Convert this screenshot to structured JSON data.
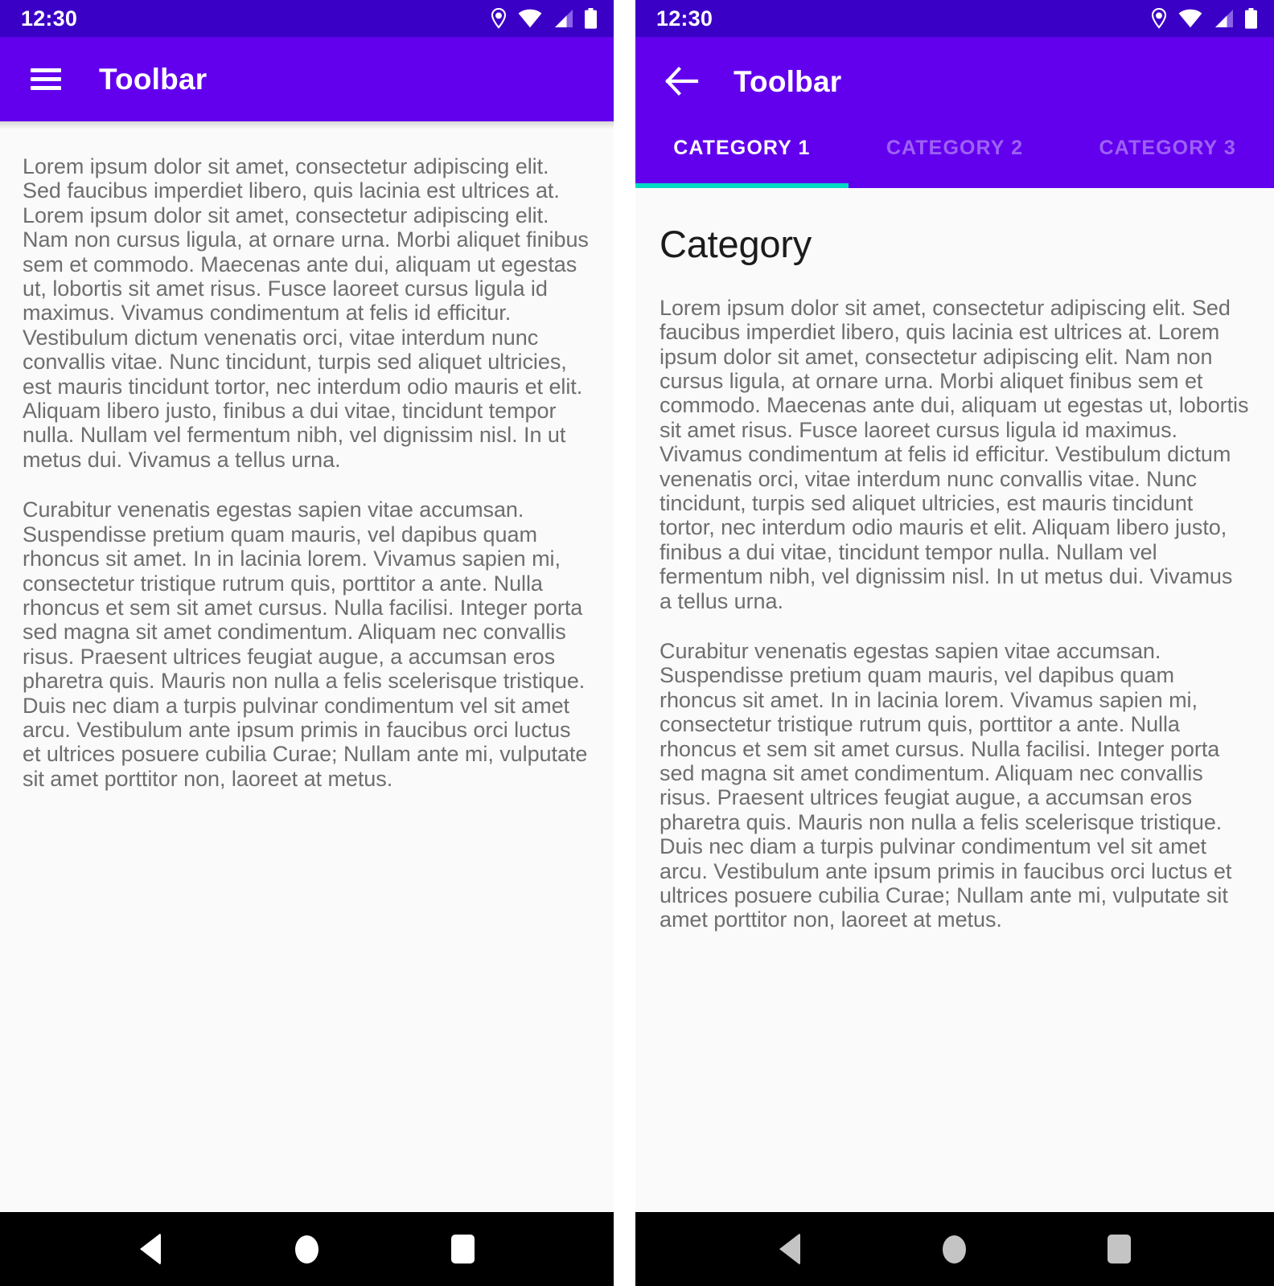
{
  "statusbar": {
    "time": "12:30",
    "icons": [
      "location-pin-icon",
      "wifi-icon",
      "cellular-signal-icon",
      "battery-icon"
    ]
  },
  "colors": {
    "status_bar": "#3b00c6",
    "toolbar": "#6200ee",
    "tab_indicator": "#03dac5",
    "content_background": "#fafafa",
    "body_text": "#6e6e6e",
    "heading_text": "#1c1c1c",
    "system_nav": "#000000",
    "system_nav_icon_left": "#ffffff",
    "system_nav_icon_right": "#c4c4c4"
  },
  "left_panel": {
    "toolbar": {
      "nav_icon": "hamburger-menu-icon",
      "title": "Toolbar"
    },
    "content": {
      "paragraphs": [
        "Lorem ipsum dolor sit amet, consectetur adipiscing elit. Sed faucibus imperdiet libero, quis lacinia est ultrices at. Lorem ipsum dolor sit amet, consectetur adipiscing elit. Nam non cursus ligula, at ornare urna. Morbi aliquet finibus sem et commodo. Maecenas ante dui, aliquam ut egestas ut, lobortis sit amet risus. Fusce laoreet cursus ligula id maximus. Vivamus condimentum at felis id efficitur. Vestibulum dictum venenatis orci, vitae interdum nunc convallis vitae. Nunc tincidunt, turpis sed aliquet ultricies, est mauris tincidunt tortor, nec interdum odio mauris et elit. Aliquam libero justo, finibus a dui vitae, tincidunt tempor nulla. Nullam vel fermentum nibh, vel dignissim nisl. In ut metus dui. Vivamus a tellus urna.",
        "Curabitur venenatis egestas sapien vitae accumsan. Suspendisse pretium quam mauris, vel dapibus quam rhoncus sit amet. In in lacinia lorem. Vivamus sapien mi, consectetur tristique rutrum quis, porttitor a ante. Nulla rhoncus et sem sit amet cursus. Nulla facilisi. Integer porta sed magna sit amet condimentum. Aliquam nec convallis risus. Praesent ultrices feugiat augue, a accumsan eros pharetra quis. Mauris non nulla a felis scelerisque tristique. Duis nec diam a turpis pulvinar condimentum vel sit amet arcu. Vestibulum ante ipsum primis in faucibus orci luctus et ultrices posuere cubilia Curae; Nullam ante mi, vulputate sit amet porttitor non, laoreet at metus."
      ]
    },
    "system_nav": {
      "back": "back-triangle-icon",
      "home": "home-circle-icon",
      "recents": "recents-square-icon"
    }
  },
  "right_panel": {
    "toolbar": {
      "nav_icon": "back-arrow-icon",
      "title": "Toolbar"
    },
    "tabs": [
      {
        "label": "CATEGORY 1",
        "active": true
      },
      {
        "label": "CATEGORY 2",
        "active": false
      },
      {
        "label": "CATEGORY 3",
        "active": false
      }
    ],
    "content": {
      "heading": "Category",
      "paragraphs": [
        "Lorem ipsum dolor sit amet, consectetur adipiscing elit. Sed faucibus imperdiet libero, quis lacinia est ultrices at. Lorem ipsum dolor sit amet, consectetur adipiscing elit. Nam non cursus ligula, at ornare urna. Morbi aliquet finibus sem et commodo. Maecenas ante dui, aliquam ut egestas ut, lobortis sit amet risus. Fusce laoreet cursus ligula id maximus. Vivamus condimentum at felis id efficitur. Vestibulum dictum venenatis orci, vitae interdum nunc convallis vitae. Nunc tincidunt, turpis sed aliquet ultricies, est mauris tincidunt tortor, nec interdum odio mauris et elit. Aliquam libero justo, finibus a dui vitae, tincidunt tempor nulla. Nullam vel fermentum nibh, vel dignissim nisl. In ut metus dui. Vivamus a tellus urna.",
        "Curabitur venenatis egestas sapien vitae accumsan. Suspendisse pretium quam mauris, vel dapibus quam rhoncus sit amet. In in lacinia lorem. Vivamus sapien mi, consectetur tristique rutrum quis, porttitor a ante. Nulla rhoncus et sem sit amet cursus. Nulla facilisi. Integer porta sed magna sit amet condimentum. Aliquam nec convallis risus. Praesent ultrices feugiat augue, a accumsan eros pharetra quis. Mauris non nulla a felis scelerisque tristique. Duis nec diam a turpis pulvinar condimentum vel sit amet arcu. Vestibulum ante ipsum primis in faucibus orci luctus et ultrices posuere cubilia Curae; Nullam ante mi, vulputate sit amet porttitor non, laoreet at metus."
      ]
    },
    "system_nav": {
      "back": "back-triangle-icon",
      "home": "home-circle-icon",
      "recents": "recents-square-icon"
    }
  }
}
